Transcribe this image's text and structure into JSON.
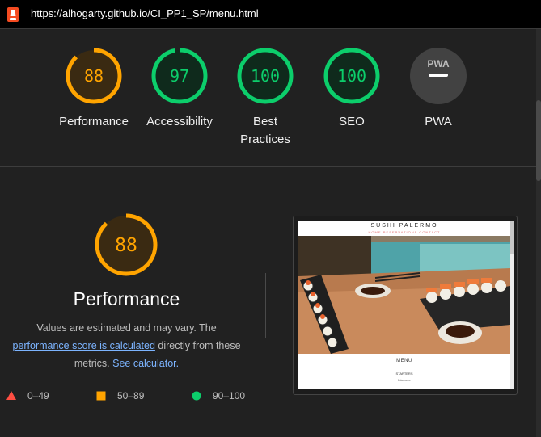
{
  "browser": {
    "url": "https://alhogarty.github.io/CI_PP1_SP/menu.html",
    "logo_icon": "lighthouse-icon"
  },
  "gauges": [
    {
      "label": "88",
      "score": 88,
      "category": "Performance",
      "color": "#ffa400"
    },
    {
      "label": "97",
      "score": 97,
      "category": "Accessibility",
      "color": "#0cce6b"
    },
    {
      "label": "100",
      "score": 100,
      "category": "Best\nPractices",
      "color": "#0cce6b"
    },
    {
      "label": "100",
      "score": 100,
      "category": "SEO",
      "color": "#0cce6b"
    },
    {
      "label": "PWA",
      "category": "PWA",
      "color": "#424242"
    }
  ],
  "performance": {
    "score_label": "88",
    "score": 88,
    "title": "Performance",
    "desc_part1": "Values are estimated and may vary. The",
    "link1": "performance score is calculated",
    "desc_part2": " directly from these metrics.",
    "link2": "See calculator."
  },
  "legend": [
    {
      "range": "0–49",
      "icon": "triangle-icon",
      "color": "#ff4e42"
    },
    {
      "range": "50–89",
      "icon": "square-icon",
      "color": "#ffa400"
    },
    {
      "range": "90–100",
      "icon": "circle-icon",
      "color": "#0cce6b"
    }
  ],
  "screenshot": {
    "site_title": "SUSHI PALERMO",
    "site_nav": "HOME  RESERVATIONS  CONTACT",
    "menu_heading": "MENU",
    "starters": "STARTERS",
    "item": "Edamame"
  }
}
